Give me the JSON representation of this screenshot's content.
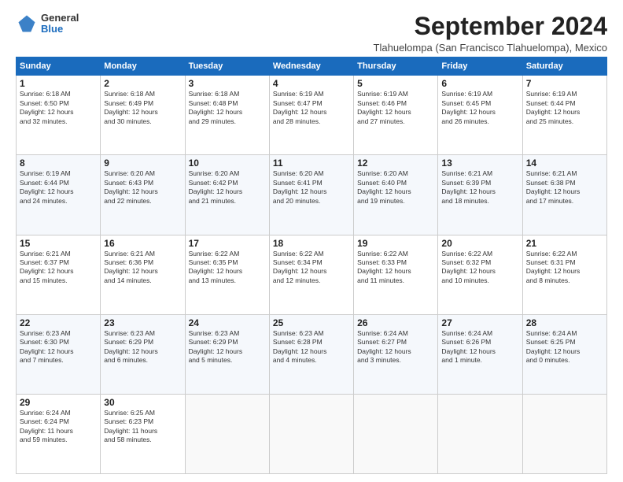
{
  "logo": {
    "general": "General",
    "blue": "Blue"
  },
  "title": "September 2024",
  "subtitle": "Tlahuelompa (San Francisco Tlahuelompa), Mexico",
  "days_of_week": [
    "Sunday",
    "Monday",
    "Tuesday",
    "Wednesday",
    "Thursday",
    "Friday",
    "Saturday"
  ],
  "weeks": [
    [
      {
        "day": "1",
        "info": "Sunrise: 6:18 AM\nSunset: 6:50 PM\nDaylight: 12 hours\nand 32 minutes."
      },
      {
        "day": "2",
        "info": "Sunrise: 6:18 AM\nSunset: 6:49 PM\nDaylight: 12 hours\nand 30 minutes."
      },
      {
        "day": "3",
        "info": "Sunrise: 6:18 AM\nSunset: 6:48 PM\nDaylight: 12 hours\nand 29 minutes."
      },
      {
        "day": "4",
        "info": "Sunrise: 6:19 AM\nSunset: 6:47 PM\nDaylight: 12 hours\nand 28 minutes."
      },
      {
        "day": "5",
        "info": "Sunrise: 6:19 AM\nSunset: 6:46 PM\nDaylight: 12 hours\nand 27 minutes."
      },
      {
        "day": "6",
        "info": "Sunrise: 6:19 AM\nSunset: 6:45 PM\nDaylight: 12 hours\nand 26 minutes."
      },
      {
        "day": "7",
        "info": "Sunrise: 6:19 AM\nSunset: 6:44 PM\nDaylight: 12 hours\nand 25 minutes."
      }
    ],
    [
      {
        "day": "8",
        "info": "Sunrise: 6:19 AM\nSunset: 6:44 PM\nDaylight: 12 hours\nand 24 minutes."
      },
      {
        "day": "9",
        "info": "Sunrise: 6:20 AM\nSunset: 6:43 PM\nDaylight: 12 hours\nand 22 minutes."
      },
      {
        "day": "10",
        "info": "Sunrise: 6:20 AM\nSunset: 6:42 PM\nDaylight: 12 hours\nand 21 minutes."
      },
      {
        "day": "11",
        "info": "Sunrise: 6:20 AM\nSunset: 6:41 PM\nDaylight: 12 hours\nand 20 minutes."
      },
      {
        "day": "12",
        "info": "Sunrise: 6:20 AM\nSunset: 6:40 PM\nDaylight: 12 hours\nand 19 minutes."
      },
      {
        "day": "13",
        "info": "Sunrise: 6:21 AM\nSunset: 6:39 PM\nDaylight: 12 hours\nand 18 minutes."
      },
      {
        "day": "14",
        "info": "Sunrise: 6:21 AM\nSunset: 6:38 PM\nDaylight: 12 hours\nand 17 minutes."
      }
    ],
    [
      {
        "day": "15",
        "info": "Sunrise: 6:21 AM\nSunset: 6:37 PM\nDaylight: 12 hours\nand 15 minutes."
      },
      {
        "day": "16",
        "info": "Sunrise: 6:21 AM\nSunset: 6:36 PM\nDaylight: 12 hours\nand 14 minutes."
      },
      {
        "day": "17",
        "info": "Sunrise: 6:22 AM\nSunset: 6:35 PM\nDaylight: 12 hours\nand 13 minutes."
      },
      {
        "day": "18",
        "info": "Sunrise: 6:22 AM\nSunset: 6:34 PM\nDaylight: 12 hours\nand 12 minutes."
      },
      {
        "day": "19",
        "info": "Sunrise: 6:22 AM\nSunset: 6:33 PM\nDaylight: 12 hours\nand 11 minutes."
      },
      {
        "day": "20",
        "info": "Sunrise: 6:22 AM\nSunset: 6:32 PM\nDaylight: 12 hours\nand 10 minutes."
      },
      {
        "day": "21",
        "info": "Sunrise: 6:22 AM\nSunset: 6:31 PM\nDaylight: 12 hours\nand 8 minutes."
      }
    ],
    [
      {
        "day": "22",
        "info": "Sunrise: 6:23 AM\nSunset: 6:30 PM\nDaylight: 12 hours\nand 7 minutes."
      },
      {
        "day": "23",
        "info": "Sunrise: 6:23 AM\nSunset: 6:29 PM\nDaylight: 12 hours\nand 6 minutes."
      },
      {
        "day": "24",
        "info": "Sunrise: 6:23 AM\nSunset: 6:29 PM\nDaylight: 12 hours\nand 5 minutes."
      },
      {
        "day": "25",
        "info": "Sunrise: 6:23 AM\nSunset: 6:28 PM\nDaylight: 12 hours\nand 4 minutes."
      },
      {
        "day": "26",
        "info": "Sunrise: 6:24 AM\nSunset: 6:27 PM\nDaylight: 12 hours\nand 3 minutes."
      },
      {
        "day": "27",
        "info": "Sunrise: 6:24 AM\nSunset: 6:26 PM\nDaylight: 12 hours\nand 1 minute."
      },
      {
        "day": "28",
        "info": "Sunrise: 6:24 AM\nSunset: 6:25 PM\nDaylight: 12 hours\nand 0 minutes."
      }
    ],
    [
      {
        "day": "29",
        "info": "Sunrise: 6:24 AM\nSunset: 6:24 PM\nDaylight: 11 hours\nand 59 minutes."
      },
      {
        "day": "30",
        "info": "Sunrise: 6:25 AM\nSunset: 6:23 PM\nDaylight: 11 hours\nand 58 minutes."
      },
      {
        "day": "",
        "info": ""
      },
      {
        "day": "",
        "info": ""
      },
      {
        "day": "",
        "info": ""
      },
      {
        "day": "",
        "info": ""
      },
      {
        "day": "",
        "info": ""
      }
    ]
  ]
}
